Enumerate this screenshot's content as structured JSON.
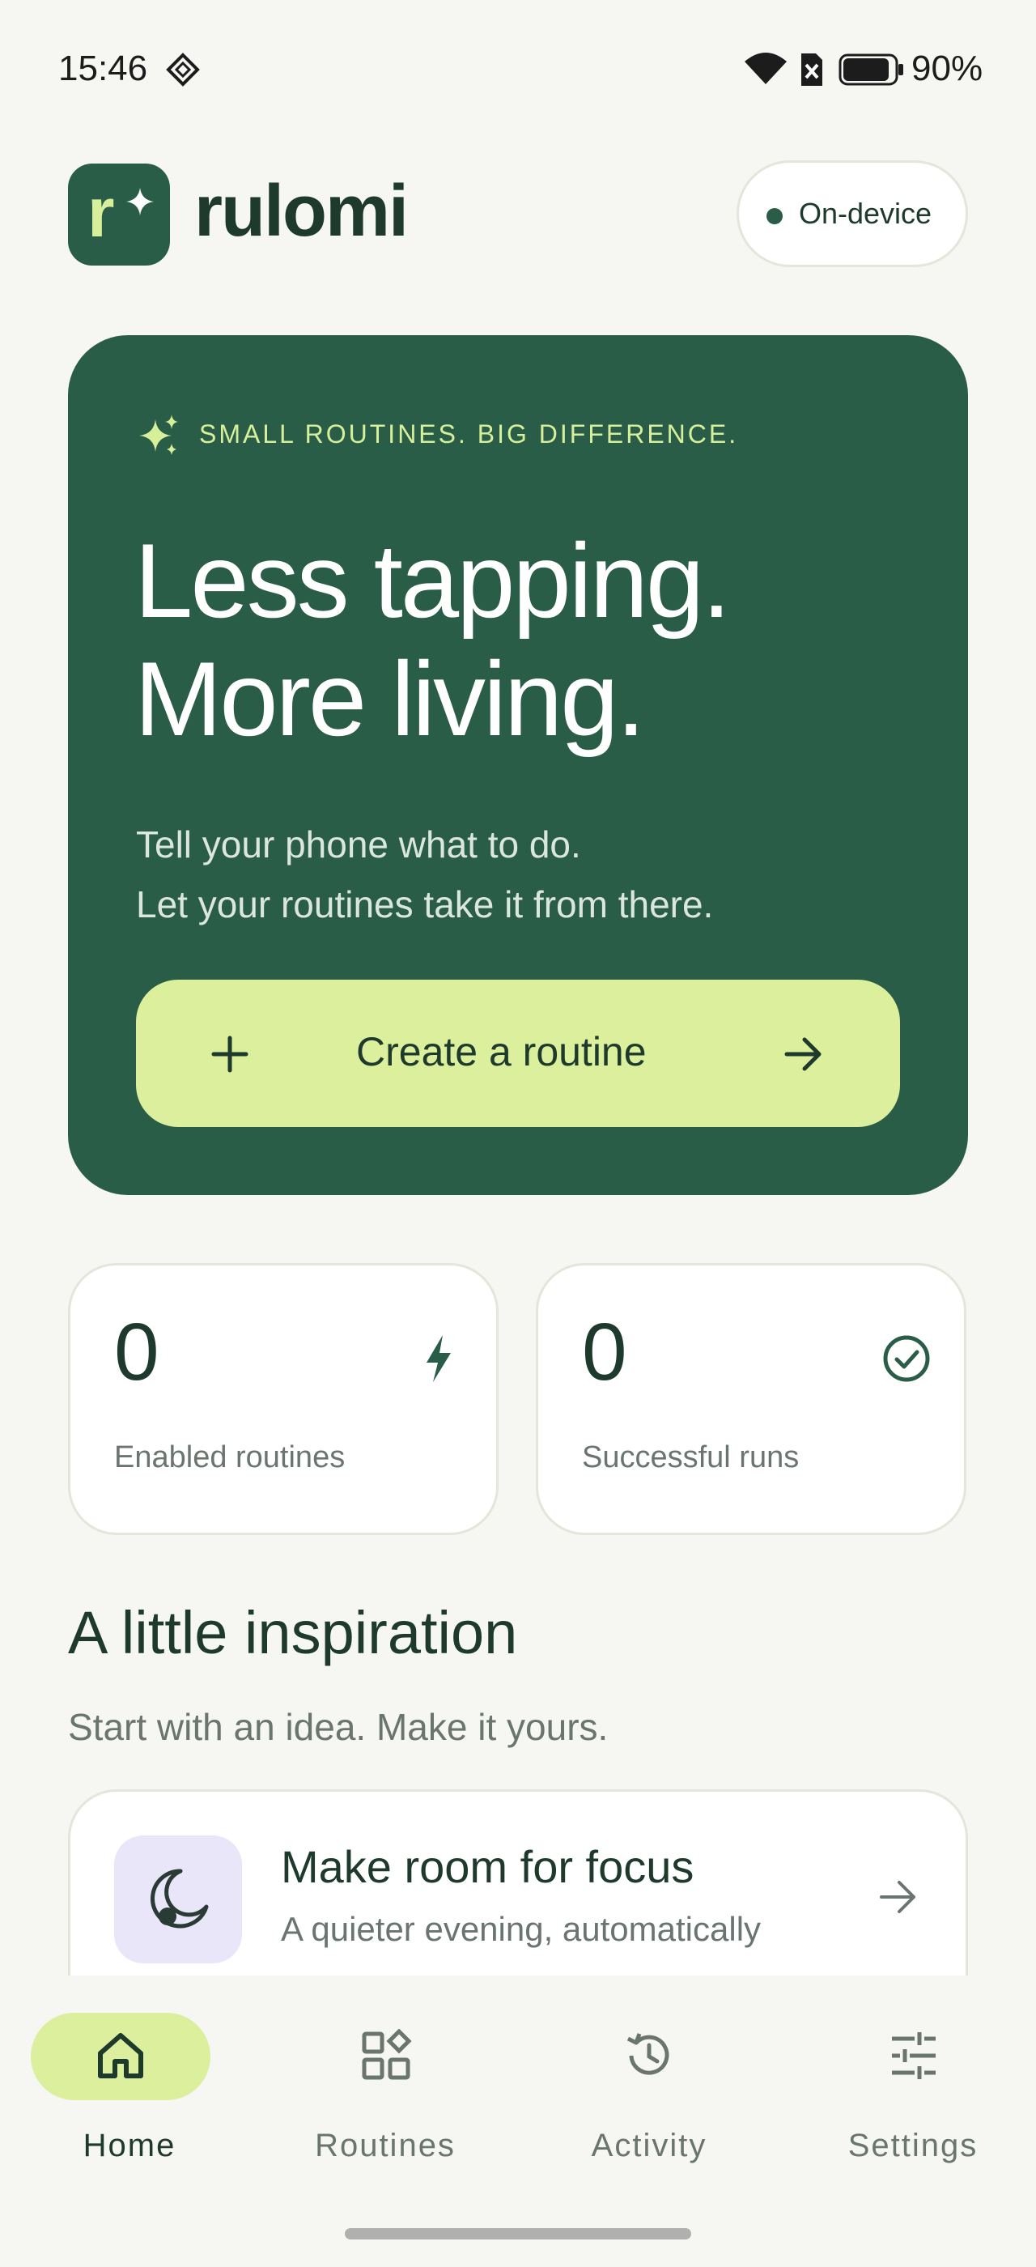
{
  "status_bar": {
    "time": "15:46",
    "battery_percent": "90%",
    "battery_level": 0.9
  },
  "header": {
    "logo_letter": "r",
    "app_name": "rulomi",
    "badge_label": "On-device"
  },
  "hero": {
    "tagline": "SMALL ROUTINES. BIG DIFFERENCE.",
    "headline_line1": "Less tapping.",
    "headline_line2": "More living.",
    "subtitle_line1": "Tell your phone what to do.",
    "subtitle_line2": "Let your routines take it from there.",
    "cta_label": "Create a routine"
  },
  "stats": [
    {
      "value": "0",
      "label": "Enabled routines",
      "icon": "bolt-icon"
    },
    {
      "value": "0",
      "label": "Successful runs",
      "icon": "check-circle-icon"
    }
  ],
  "inspiration": {
    "title": "A little inspiration",
    "subtitle": "Start with an idea. Make it yours.",
    "cards": [
      {
        "title": "Make room for focus",
        "subtitle": "A quieter evening, automatically",
        "icon": "moon-icon"
      }
    ]
  },
  "nav": {
    "items": [
      {
        "label": "Home",
        "icon": "home-icon",
        "active": true
      },
      {
        "label": "Routines",
        "icon": "routines-grid-icon",
        "active": false
      },
      {
        "label": "Activity",
        "icon": "history-icon",
        "active": false
      },
      {
        "label": "Settings",
        "icon": "sliders-icon",
        "active": false
      }
    ]
  },
  "colors": {
    "brand_green": "#2a5d47",
    "accent_lime": "#dbef9d",
    "background": "#f6f6f2",
    "text_dark": "#1e3a2c",
    "text_muted": "#6a7570",
    "idea_tile": "#e9e6f9"
  }
}
